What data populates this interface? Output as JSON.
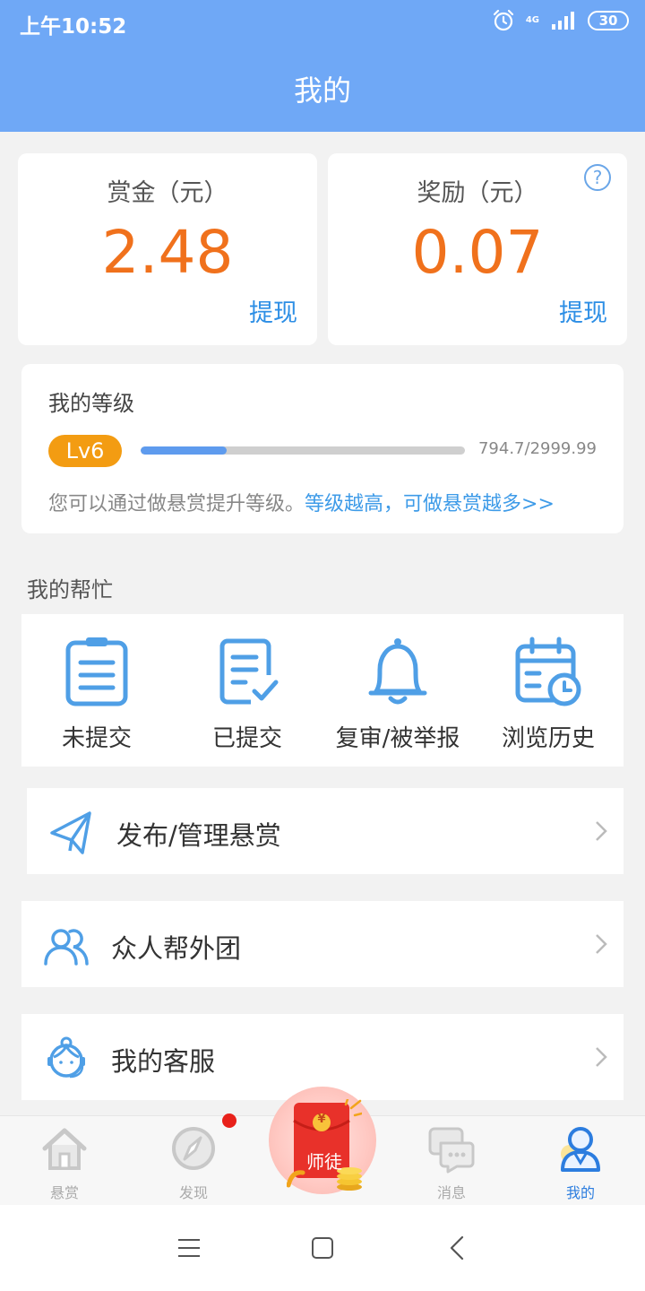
{
  "status_bar": {
    "time": "上午10:52",
    "network": "4G",
    "battery": "30"
  },
  "header": {
    "title": "我的"
  },
  "balances": {
    "bounty": {
      "label": "赏金（元）",
      "value": "2.48",
      "action": "提现"
    },
    "reward": {
      "label": "奖励（元）",
      "value": "0.07",
      "action": "提现",
      "help_icon": "?"
    }
  },
  "level": {
    "title": "我的等级",
    "badge": "Lv6",
    "progress_text": "794.7/2999.99",
    "progress_fraction": 0.265,
    "tip": "您可以通过做悬赏提升等级。",
    "tip_link": "等级越高，可做悬赏越多>>"
  },
  "my_help": {
    "title": "我的帮忙",
    "items": [
      {
        "label": "未提交",
        "icon": "clipboard-icon"
      },
      {
        "label": "已提交",
        "icon": "checked-doc-icon"
      },
      {
        "label": "复审/被举报",
        "icon": "bell-icon"
      },
      {
        "label": "浏览历史",
        "icon": "calendar-clock-icon"
      }
    ]
  },
  "menu": {
    "items": [
      {
        "label": "发布/管理悬赏",
        "icon": "paper-plane-icon"
      },
      {
        "label": "众人帮外团",
        "icon": "users-icon"
      },
      {
        "label": "我的客服",
        "icon": "customer-service-icon"
      }
    ]
  },
  "tabbar": {
    "tabs": [
      {
        "label": "悬赏",
        "icon": "home-icon",
        "active": false
      },
      {
        "label": "发现",
        "icon": "compass-icon",
        "active": false,
        "badge": true
      },
      {
        "label": "师徒",
        "icon": "red-envelope-icon",
        "center": true
      },
      {
        "label": "消息",
        "icon": "chat-icon",
        "active": false
      },
      {
        "label": "我的",
        "icon": "profile-icon",
        "active": true
      }
    ],
    "center_symbol": "¥"
  },
  "colors": {
    "header": "#6fa8f6",
    "accent_orange": "#f0711c",
    "link_blue": "#2c8ee5",
    "badge": "#f39c12"
  }
}
